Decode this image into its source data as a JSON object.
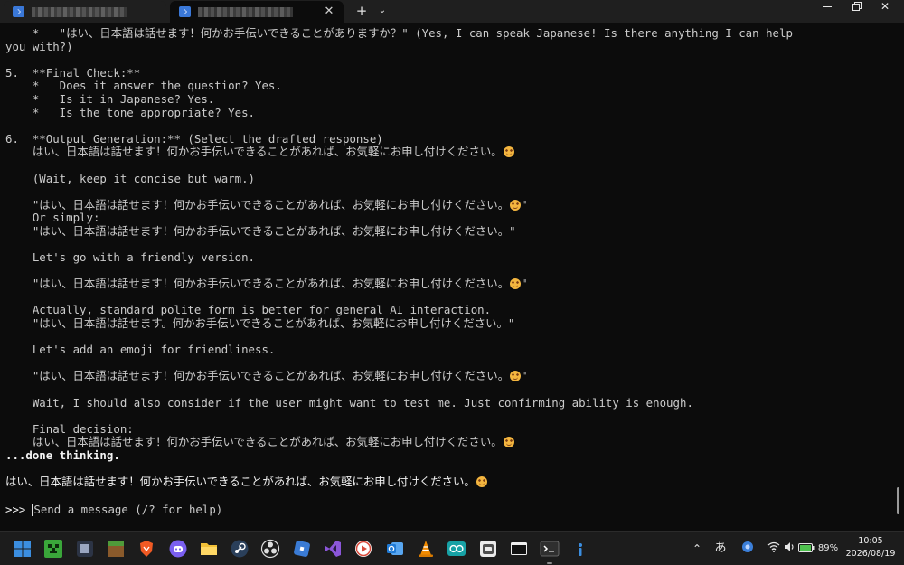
{
  "window": {
    "new_tab_symbol": "+",
    "dropdown_symbol": "⌄",
    "close_tab_symbol": "✕",
    "minimize_symbol": "",
    "close_symbol": "✕"
  },
  "terminal": {
    "lines": [
      "    *   \"はい、日本語は話せます！何かお手伝いできることがありますか？\" (Yes, I can speak Japanese! Is there anything I can help",
      "you with?)",
      "",
      "5.  **Final Check:**",
      "    *   Does it answer the question? Yes.",
      "    *   Is it in Japanese? Yes.",
      "    *   Is the tone appropriate? Yes.",
      "",
      "6.  **Output Generation:** (Select the drafted response)",
      "    はい、日本語は話せます！何かお手伝いできることがあれば、お気軽にお申し付けください。",
      "",
      "    (Wait, keep it concise but warm.)",
      "",
      "    \"はい、日本語は話せます！何かお手伝いできることがあれば、お気軽にお申し付けください。",
      "    Or simply:",
      "    \"はい、日本語は話せます！何かお手伝いできることがあれば、お気軽にお申し付けください。\"",
      "",
      "    Let's go with a friendly version.",
      "",
      "    \"はい、日本語は話せます！何かお手伝いできることがあれば、お気軽にお申し付けください。",
      "",
      "    Actually, standard polite form is better for general AI interaction.",
      "    \"はい、日本語は話せます。何かお手伝いできることがあれば、お気軽にお申し付けください。\"",
      "",
      "    Let's add an emoji for friendliness.",
      "",
      "    \"はい、日本語は話せます！何かお手伝いできることがあれば、お気軽にお申し付けください。",
      "",
      "    Wait, I should also consider if the user might want to test me. Just confirming ability is enough.",
      "",
      "    Final decision:",
      "    はい、日本語は話せます！何かお手伝いできることがあれば、お気軽にお申し付けください。",
      "...done thinking.",
      "",
      "はい、日本語は話せます！何かお手伝いできることがあれば、お気軽にお申し付けください。"
    ],
    "line_suffix_emoji": [
      9,
      13,
      19,
      26,
      31,
      34
    ],
    "line_suffix_after_emoji": {
      "13": "\"",
      "19": "\"",
      "26": "\""
    },
    "bright_lines": [
      32,
      34
    ],
    "bold_lines": [
      32
    ],
    "prompt_symbol": ">>>",
    "prompt_placeholder": "Send a message (/? for help)"
  },
  "taskbar": {
    "ime_label": "あ",
    "battery": "89%",
    "time": "10:05",
    "date": "2026/08/19",
    "apps": [
      {
        "name": "start-button",
        "icon": "windows-logo-icon",
        "color": "#3b8ee0"
      },
      {
        "name": "minecraft-app",
        "icon": "creeper-icon",
        "color": "#3aa63a"
      },
      {
        "name": "dark-app",
        "icon": "app-icon",
        "color": "#2c3445"
      },
      {
        "name": "grass-block-app",
        "icon": "grass-block-icon",
        "color": "#8a5a2b"
      },
      {
        "name": "brave-browser",
        "icon": "brave-lion-icon",
        "color": "#f05a24"
      },
      {
        "name": "discord-app",
        "icon": "discord-icon",
        "color": "#7a5ff0"
      },
      {
        "name": "file-explorer",
        "icon": "folder-icon",
        "color": "#f2c037"
      },
      {
        "name": "steam-app",
        "icon": "steam-icon",
        "color": "#2a3f5a"
      },
      {
        "name": "obs-studio",
        "icon": "obs-icon",
        "color": "#3c3c3c"
      },
      {
        "name": "roblox-app",
        "icon": "roblox-icon",
        "color": "#3a7bd5"
      },
      {
        "name": "visual-studio",
        "icon": "visual-studio-icon",
        "color": "#8b56d9"
      },
      {
        "name": "media-player",
        "icon": "play-icon",
        "color": "#d84b3c"
      },
      {
        "name": "outlook-app",
        "icon": "outlook-icon",
        "color": "#1f7ad6"
      },
      {
        "name": "vlc-player",
        "icon": "vlc-cone-icon",
        "color": "#f08a00"
      },
      {
        "name": "arduino-ide",
        "icon": "arduino-icon",
        "color": "#17a1a5"
      },
      {
        "name": "github-desktop",
        "icon": "github-icon",
        "color": "#4d4d4d"
      },
      {
        "name": "terminal-app",
        "icon": "terminal-icon",
        "color": "#3a3a3a"
      },
      {
        "name": "terminal-active",
        "icon": "terminal-prompt-icon",
        "color": "#2f2f2f"
      },
      {
        "name": "info-app",
        "icon": "info-icon",
        "color": "#3b8ee0"
      }
    ]
  }
}
